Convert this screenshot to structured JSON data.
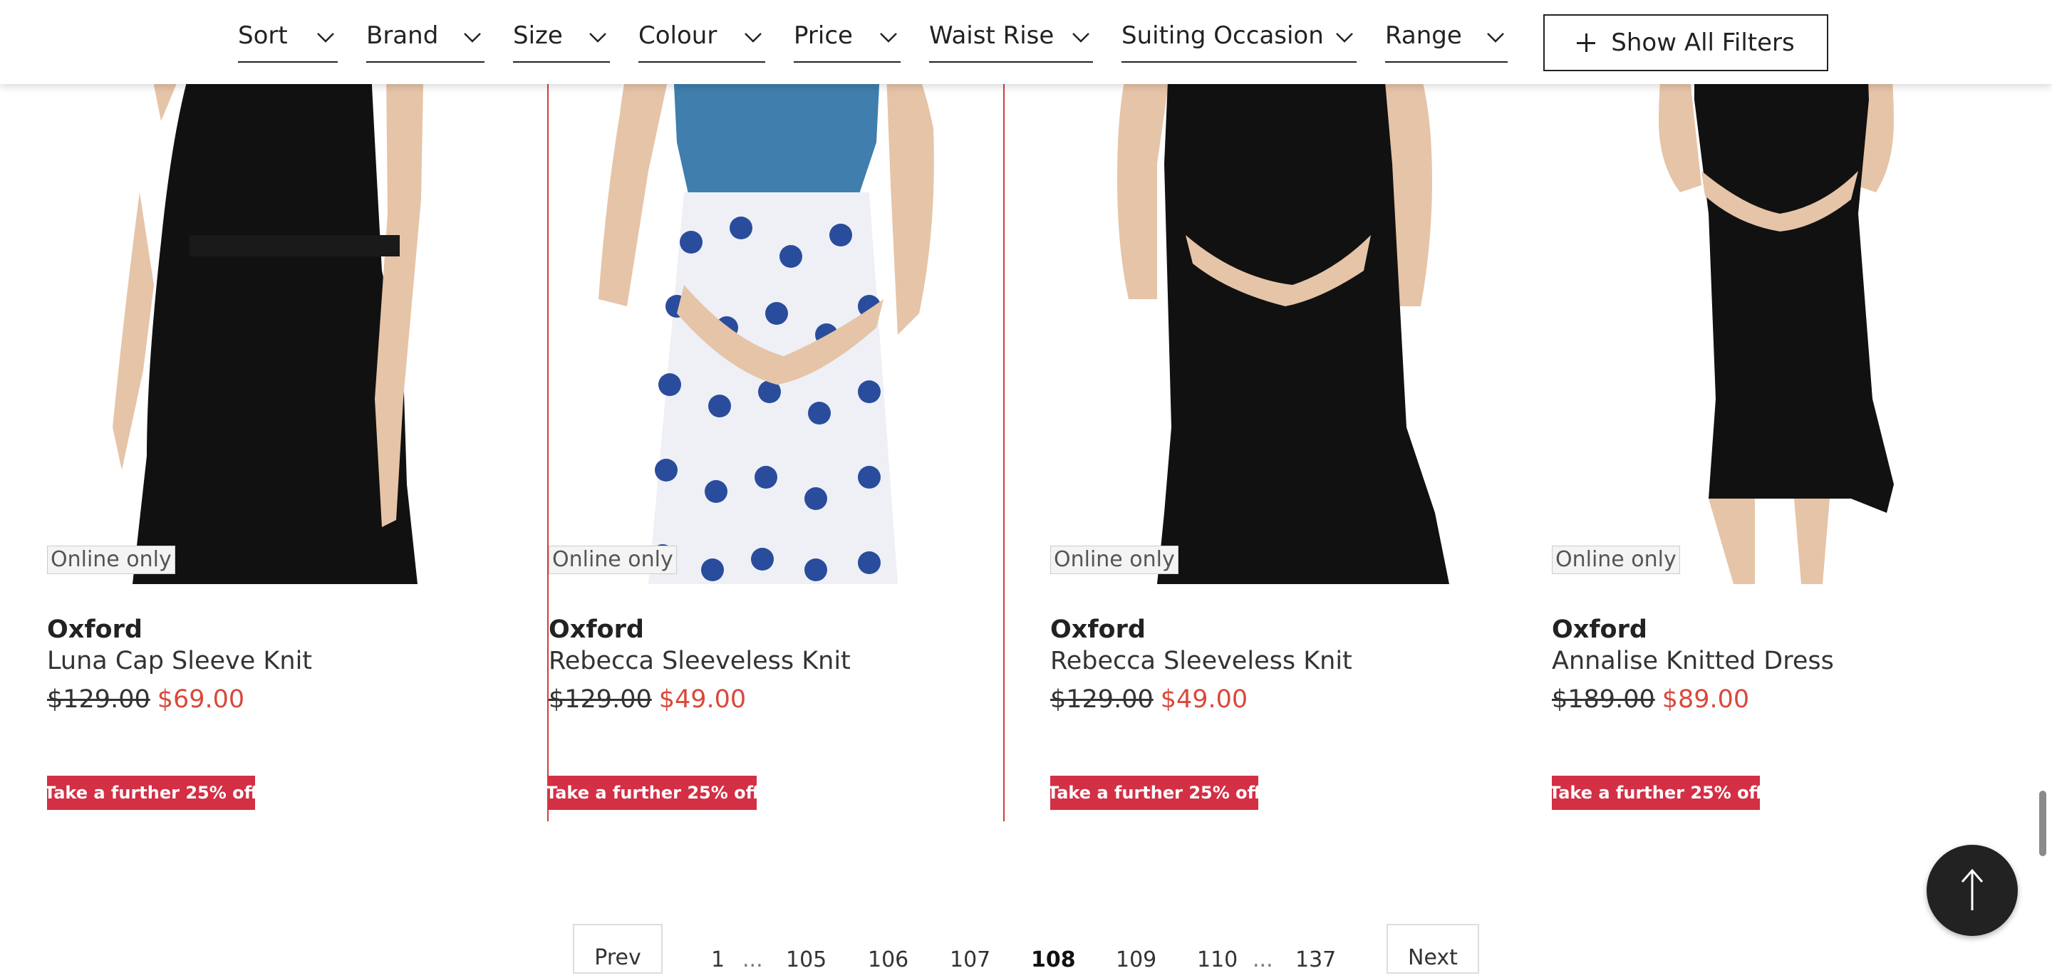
{
  "filters": [
    {
      "label": "Sort"
    },
    {
      "label": "Brand"
    },
    {
      "label": "Size"
    },
    {
      "label": "Colour"
    },
    {
      "label": "Price"
    },
    {
      "label": "Waist Rise"
    },
    {
      "label": "Suiting Occasion"
    },
    {
      "label": "Range"
    }
  ],
  "show_all_filters": "Show All Filters",
  "products": [
    {
      "badge": "Online only",
      "brand": "Oxford",
      "name": "Luna Cap Sleeve Knit",
      "was": "$129.00",
      "now": "$69.00",
      "promo": "Take a further 25% off"
    },
    {
      "badge": "Online only",
      "brand": "Oxford",
      "name": "Rebecca Sleeveless Knit",
      "was": "$129.00",
      "now": "$49.00",
      "promo": "Take a further 25% off"
    },
    {
      "badge": "Online only",
      "brand": "Oxford",
      "name": "Rebecca Sleeveless Knit",
      "was": "$129.00",
      "now": "$49.00",
      "promo": "Take a further 25% off"
    },
    {
      "badge": "Online only",
      "brand": "Oxford",
      "name": "Annalise Knitted Dress",
      "was": "$189.00",
      "now": "$89.00",
      "promo": "Take a further 25% off"
    }
  ],
  "pagination": {
    "prev": "Prev",
    "next": "Next",
    "pages": [
      "1",
      "105",
      "106",
      "107",
      "108",
      "109",
      "110",
      "137"
    ],
    "current": "108",
    "ellipsis": "..."
  },
  "colors": {
    "accent_red": "#d9493a",
    "promo_bg": "#d32f45",
    "hover_border": "#d43b3b"
  },
  "icons": [
    "chevron-down-icon",
    "plus-icon",
    "arrow-up-icon"
  ]
}
